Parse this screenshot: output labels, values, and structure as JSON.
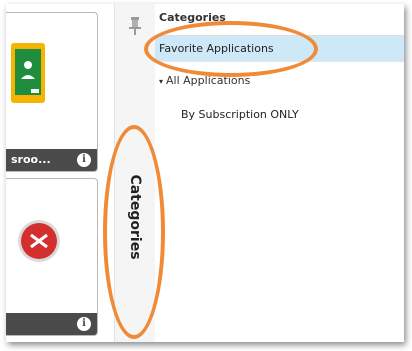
{
  "tiles": [
    {
      "name": "Google Classroom",
      "label": "sroo...",
      "info_icon": "i",
      "icon": "classroom-icon"
    },
    {
      "name": "red app",
      "label": "",
      "info_icon": "i",
      "icon": "red-app-icon"
    }
  ],
  "vertical_tab": {
    "label": "Categories",
    "pin_icon": "pin-icon"
  },
  "categories_panel": {
    "header": "Categories",
    "items": [
      {
        "label": "Favorite Applications",
        "selected": true
      },
      {
        "label": "All Applications",
        "expanded": true,
        "caret": "▾"
      },
      {
        "label": "By Subscription ONLY"
      }
    ]
  },
  "colors": {
    "annotation": "#f08a36",
    "selected_row": "#cde8f7",
    "tile_footer": "#4b4b4b"
  }
}
